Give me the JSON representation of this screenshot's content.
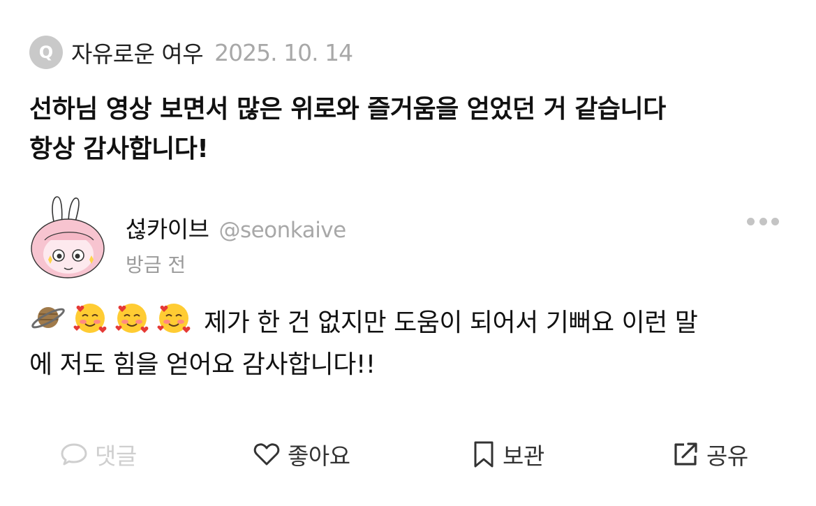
{
  "question": {
    "badge": "Q",
    "author": "자유로운 여우",
    "date": "2025. 10. 14",
    "lines": [
      "선하님 영상 보면서 많은 위로와 즐거움을 얻었던 거 같습니다",
      "항상 감사합니다!"
    ]
  },
  "answer": {
    "name": "섢카이브",
    "handle": "@seonkaive",
    "time": "방금 전",
    "line1": "제가 한 건 없지만 도움이 되어서 기뻐요 이런 말",
    "line2": "에 저도 힘을 얻어요 감사합니다!!",
    "emojis": [
      "ringed-planet",
      "smiling-face-with-hearts",
      "smiling-face-with-hearts",
      "smiling-face-with-hearts"
    ]
  },
  "actions": {
    "comment": "댓글",
    "like": "좋아요",
    "save": "보관",
    "share": "공유"
  },
  "colors": {
    "muted": "#a8a8a8",
    "disabled": "#cfcfcf",
    "badge": "#c9c9c9"
  }
}
